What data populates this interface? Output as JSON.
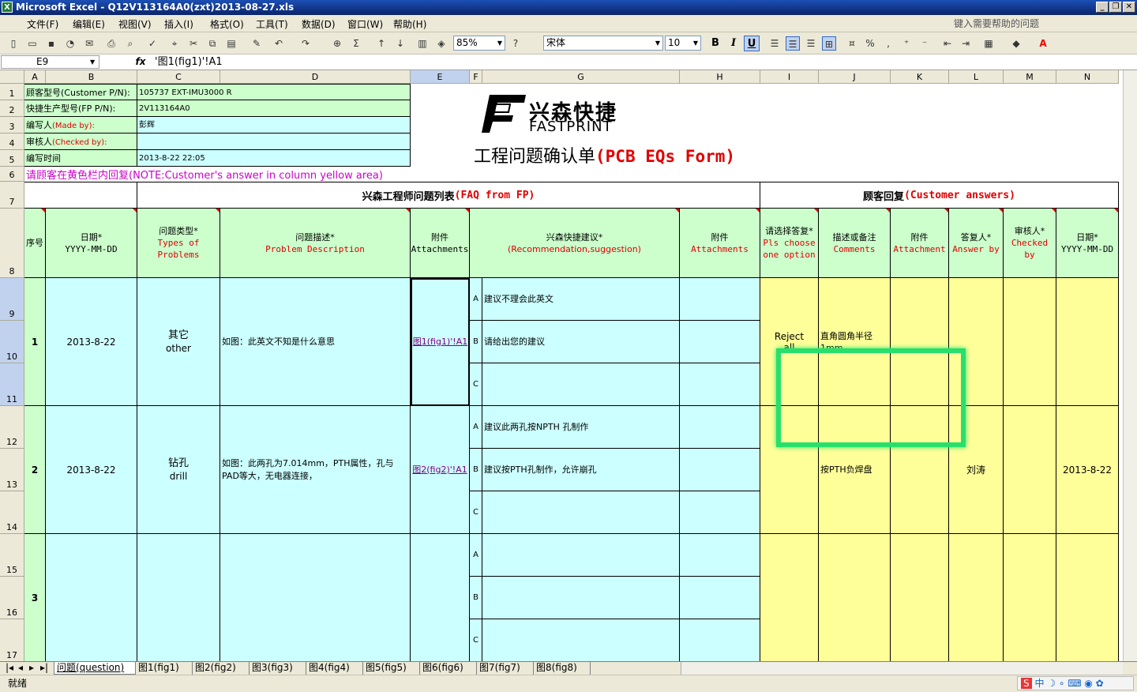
{
  "window": {
    "title": "Microsoft Excel - Q12V113164A0(zxt)2013-08-27.xls",
    "app_icon": "excel-icon"
  },
  "menu": [
    "文件(F)",
    "编辑(E)",
    "视图(V)",
    "插入(I)",
    "格式(O)",
    "工具(T)",
    "数据(D)",
    "窗口(W)",
    "帮助(H)"
  ],
  "help_placeholder": "键入需要帮助的问题",
  "toolbar": {
    "zoom": "85%",
    "font": "宋体",
    "size": "10",
    "bold": "B",
    "italic": "I",
    "underline": "U"
  },
  "formula": {
    "namebox": "E9",
    "fx": "fx",
    "content": "'图1(fig1)'!A1"
  },
  "columns": [
    "A",
    "B",
    "C",
    "D",
    "E",
    "F",
    "G",
    "H",
    "I",
    "J",
    "K",
    "L",
    "M",
    "N"
  ],
  "rows": [
    "1",
    "2",
    "3",
    "4",
    "5",
    "6",
    "7",
    "8",
    "9",
    "10",
    "11",
    "12",
    "13",
    "14",
    "15",
    "16",
    "17"
  ],
  "header_info": [
    {
      "label": "顾客型号(Customer P/N):",
      "value": "105737 EXT-IMU3000 R"
    },
    {
      "label": "快捷生产型号(FP P/N):",
      "value": "2V113164A0"
    },
    {
      "label": "编写人",
      "label_en": "(Made by):",
      "value": "彭辉"
    },
    {
      "label": "审核人",
      "label_en": "(Checked by):",
      "value": ""
    },
    {
      "label": "编写时间",
      "value": "2013-8-22 22:05"
    }
  ],
  "logo": {
    "cn": "兴森快捷",
    "en": "FASTPRINT"
  },
  "form_title": {
    "cn": "工程问题确认单",
    "en": "(PCB EQs Form)"
  },
  "note": "请顾客在黄色栏内回复(NOTE:Customer's answer in column yellow area)",
  "section_faq": {
    "cn": "兴森工程师问题列表",
    "en": "(FAQ from FP)"
  },
  "section_customer": {
    "cn": "顾客回复",
    "en": "(Customer answers)"
  },
  "col_headers": {
    "seq": "序号",
    "date": "日期*",
    "date_fmt": "YYYY-MM-DD",
    "type_cn": "问题类型*",
    "type_en": "Types of Problems",
    "desc_cn": "问题描述*",
    "desc_en": "Problem Description",
    "att_cn": "附件",
    "att_en": "Attachments",
    "rec_cn": "兴森快捷建议*",
    "rec_en": "(Recommendation,suggestion)",
    "att2_cn": "附件",
    "att2_en": "Attachments",
    "choose_cn": "请选择答复*",
    "choose_en": "Pls choose one option",
    "comm_cn": "描述或备注",
    "comm_en": "Comments",
    "att3_cn": "附件",
    "att3_en": "Attachment",
    "ans_cn": "答复人*",
    "ans_en": "Answer by",
    "chk_cn": "审核人*",
    "chk_en": "Checked by",
    "date2": "日期*",
    "date2_fmt": "YYYY-MM-DD"
  },
  "items": [
    {
      "no": "1",
      "date": "2013-8-22",
      "type_cn": "其它",
      "type_en": "other",
      "desc": "如图：此英文不知是什么意思",
      "att": "图1(fig1)'!A1",
      "options": [
        {
          "k": "A",
          "t": "建议不理会此英文"
        },
        {
          "k": "B",
          "t": "请给出您的建议"
        },
        {
          "k": "C",
          "t": ""
        }
      ],
      "choice": "Reject all",
      "comment": "直角圆角半径1mm。",
      "answer_by": "",
      "checked_by": "",
      "date2": ""
    },
    {
      "no": "2",
      "date": "2013-8-22",
      "type_cn": "钻孔",
      "type_en": "drill",
      "desc": "如图：此两孔为7.014mm，PTH属性，孔与PAD等大，无电器连接，",
      "att": "图2(fig2)'!A1",
      "options": [
        {
          "k": "A",
          "t": "建议此两孔按NPTH 孔制作"
        },
        {
          "k": "B",
          "t": "建议按PTH孔制作，允许崩孔"
        },
        {
          "k": "C",
          "t": ""
        }
      ],
      "choice": "",
      "comment": "按PTH负焊盘",
      "answer_by": "刘涛",
      "checked_by": "",
      "date2": "2013-8-22"
    },
    {
      "no": "3",
      "date": "",
      "type_cn": "",
      "type_en": "",
      "desc": "",
      "att": "",
      "options": [
        {
          "k": "A",
          "t": ""
        },
        {
          "k": "B",
          "t": ""
        },
        {
          "k": "C",
          "t": ""
        }
      ],
      "choice": "",
      "comment": "",
      "answer_by": "",
      "checked_by": "",
      "date2": ""
    }
  ],
  "sheets": [
    "问题(question)",
    "图1(fig1)",
    "图2(fig2)",
    "图3(fig3)",
    "图4(fig4)",
    "图5(fig5)",
    "图6(fig6)",
    "图7(fig7)",
    "图8(fig8)"
  ],
  "status": "就绪",
  "ime": "中"
}
